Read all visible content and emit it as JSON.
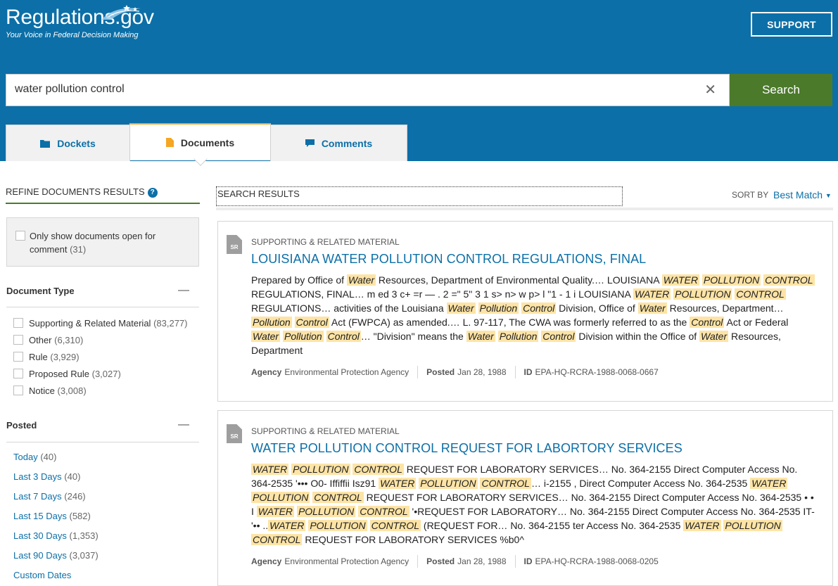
{
  "header": {
    "logo": "Regulations.gov",
    "tagline": "Your Voice in Federal Decision Making",
    "support": "SUPPORT"
  },
  "search": {
    "query": "water pollution control",
    "button": "Search"
  },
  "tabs": [
    {
      "label": "Dockets",
      "icon": "folder-icon",
      "active": false
    },
    {
      "label": "Documents",
      "icon": "document-icon",
      "active": true
    },
    {
      "label": "Comments",
      "icon": "comment-icon",
      "active": false
    }
  ],
  "sidebar": {
    "title": "REFINE DOCUMENTS RESULTS",
    "open_only": {
      "label": "Only show documents open for comment",
      "count": "(31)"
    },
    "document_type": {
      "title": "Document Type",
      "items": [
        {
          "label": "Supporting & Related Material",
          "count": "(83,277)"
        },
        {
          "label": "Other",
          "count": "(6,310)"
        },
        {
          "label": "Rule",
          "count": "(3,929)"
        },
        {
          "label": "Proposed Rule",
          "count": "(3,027)"
        },
        {
          "label": "Notice",
          "count": "(3,008)"
        }
      ]
    },
    "posted": {
      "title": "Posted",
      "items": [
        {
          "label": "Today",
          "count": "(40)"
        },
        {
          "label": "Last 3 Days",
          "count": "(40)"
        },
        {
          "label": "Last 7 Days",
          "count": "(246)"
        },
        {
          "label": "Last 15 Days",
          "count": "(582)"
        },
        {
          "label": "Last 30 Days",
          "count": "(1,353)"
        },
        {
          "label": "Last 90 Days",
          "count": "(3,037)"
        },
        {
          "label": "Custom Dates",
          "count": ""
        }
      ]
    }
  },
  "results": {
    "label": "SEARCH RESULTS",
    "sort_by": "SORT BY",
    "sort_value": "Best Match",
    "items": [
      {
        "badge": "SR",
        "type": "SUPPORTING & RELATED MATERIAL",
        "title": "LOUISIANA WATER POLLUTION CONTROL REGULATIONS, FINAL",
        "agency_label": "Agency",
        "agency": "Environmental Protection Agency",
        "posted_label": "Posted",
        "posted": "Jan 28, 1988",
        "id_label": "ID",
        "id": "EPA-HQ-RCRA-1988-0068-0667"
      },
      {
        "badge": "SR",
        "type": "SUPPORTING & RELATED MATERIAL",
        "title": "WATER POLLUTION CONTROL REQUEST FOR LABORTORY SERVICES",
        "agency_label": "Agency",
        "agency": "Environmental Protection Agency",
        "posted_label": "Posted",
        "posted": "Jan 28, 1988",
        "id_label": "ID",
        "id": "EPA-HQ-RCRA-1988-0068-0205"
      }
    ]
  },
  "colors": {
    "header_bg": "#0c6fa7",
    "search_button": "#4b7a2b",
    "active_tab_accent": "#f5a623",
    "highlight": "#fde4a6",
    "link": "#0c6fa7"
  }
}
